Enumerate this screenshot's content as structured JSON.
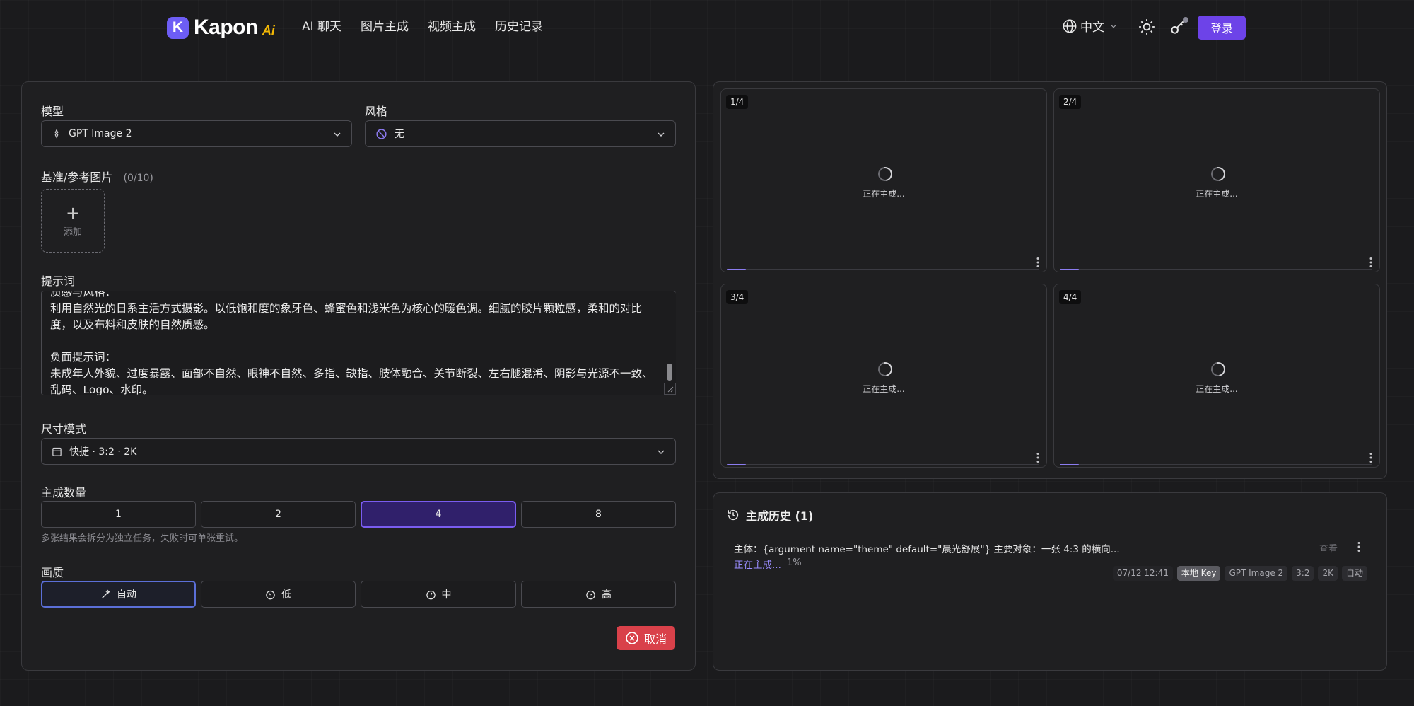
{
  "header": {
    "logo_text": "Kapon",
    "logo_ai": "Ai",
    "nav": [
      "AI 聊天",
      "图片主成",
      "视频主成",
      "历史记录"
    ],
    "language": "中文",
    "login_label": "登录"
  },
  "form": {
    "model_label": "模型",
    "model_value": "GPT Image 2",
    "style_label": "风格",
    "style_value": "无",
    "reference_label": "基准/参考图片",
    "reference_count": "(0/10)",
    "add_label": "添加",
    "prompt_label": "提示词",
    "prompt_text": "质感与风格：\n利用自然光的日系主活方式摄影。以低饱和度的象牙色、蜂蜜色和浅米色为核心的暖色调。细腻的胶片颗粒感，柔和的对比度，以及布料和皮肤的自然质感。\n\n负面提示词：\n未成年人外貌、过度暴露、面部不自然、眼神不自然、多指、缺指、肢体融合、关节断裂、左右腿混淆、阴影与光源不一致、乱码、Logo、水印。",
    "size_mode_label": "尺寸模式",
    "size_mode_value": "快捷 · 3:2 · 2K",
    "count_label": "主成数量",
    "count_options": [
      "1",
      "2",
      "4",
      "8"
    ],
    "count_selected": "4",
    "count_hint": "多张结果会拆分为独立任务，失败时可单张重试。",
    "quality_label": "画质",
    "quality_options": [
      "自动",
      "低",
      "中",
      "高"
    ],
    "quality_selected": "自动",
    "cancel_label": "取消"
  },
  "tiles": [
    {
      "badge": "1/4",
      "status": "正在主成...",
      "progress": 0.06
    },
    {
      "badge": "2/4",
      "status": "正在主成...",
      "progress": 0.06
    },
    {
      "badge": "3/4",
      "status": "正在主成...",
      "progress": 0.06
    },
    {
      "badge": "4/4",
      "status": "正在主成...",
      "progress": 0.06
    }
  ],
  "history": {
    "title": "主成历史 (1)",
    "items": [
      {
        "prompt": "主体：{argument name=\"theme\" default=\"晨光舒展\"} 主要对象：一张 4:3 的横向...",
        "status": "正在主成...",
        "percent": "1%",
        "view_label": "查看",
        "tags": [
          "07/12 12:41",
          "本地 Key",
          "GPT Image 2",
          "3:2",
          "2K",
          "自动"
        ]
      }
    ]
  },
  "colors": {
    "accent": "#6d43e8",
    "cancel": "#d9414a",
    "progress": "#8b7cf0",
    "background": "#1b1b1d"
  }
}
